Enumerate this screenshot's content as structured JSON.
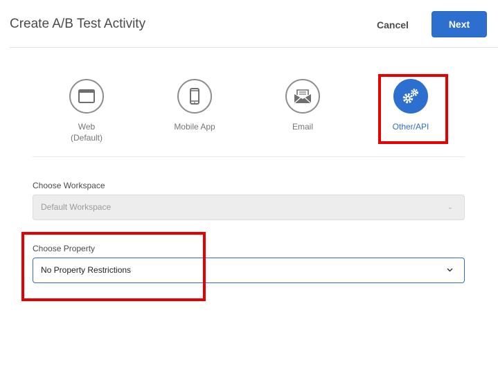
{
  "dialog": {
    "title": "Create A/B Test Activity",
    "cancel_label": "Cancel",
    "next_label": "Next"
  },
  "activity_types": [
    {
      "label": "Web\n(Default)",
      "icon": "browser-window-icon",
      "selected": false
    },
    {
      "label": "Mobile App",
      "icon": "mobile-phone-icon",
      "selected": false
    },
    {
      "label": "Email",
      "icon": "envelope-icon",
      "selected": false
    },
    {
      "label": "Other/API",
      "icon": "gears-icon",
      "selected": true
    }
  ],
  "workspace": {
    "label": "Choose Workspace",
    "value": "Default Workspace",
    "disabled": true
  },
  "property": {
    "label": "Choose Property",
    "value": "No Property Restrictions",
    "disabled": false
  },
  "colors": {
    "accent": "#2d6fcf",
    "highlight": "#e60000"
  }
}
